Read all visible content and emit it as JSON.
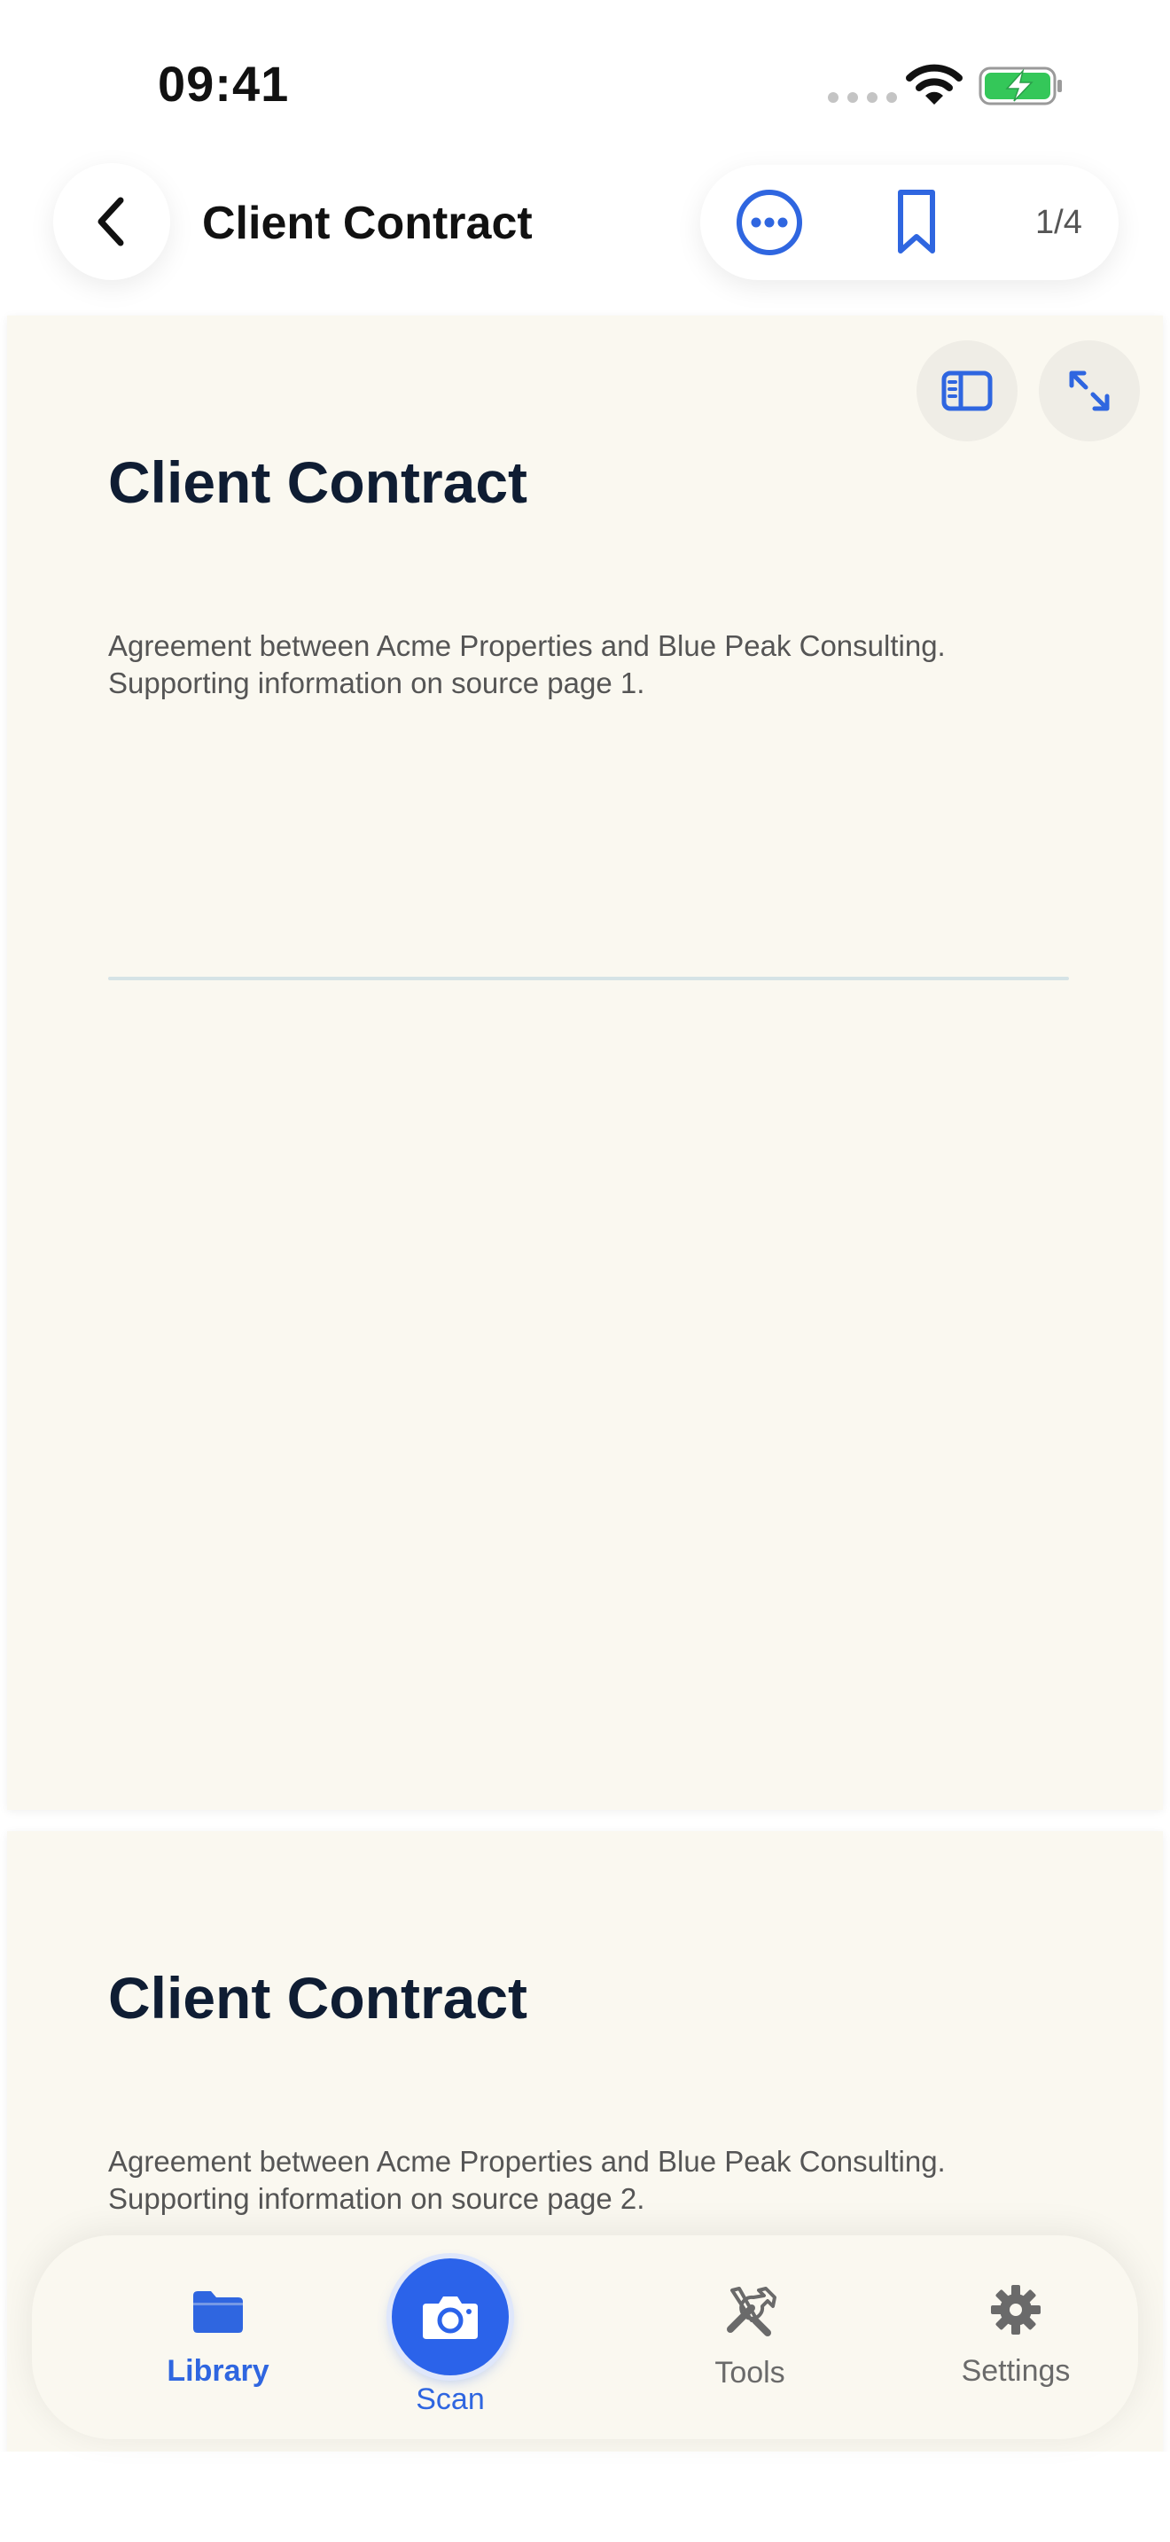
{
  "status_bar": {
    "time": "09:41"
  },
  "header": {
    "title": "Client Contract",
    "page_counter": "1/4"
  },
  "pages": [
    {
      "title": "Client Contract",
      "body_line1": "Agreement between Acme Properties and Blue Peak Consulting.",
      "body_line2": "Supporting information on source page 1."
    },
    {
      "title": "Client Contract",
      "body_line1": "Agreement between Acme Properties and Blue Peak Consulting.",
      "body_line2": "Supporting information on source page 2."
    }
  ],
  "tab_bar": {
    "tabs": [
      {
        "label": "Library",
        "icon": "folder-icon",
        "active": true
      },
      {
        "label": "Scan",
        "icon": "camera-icon",
        "active": false
      },
      {
        "label": "Tools",
        "icon": "tools-icon",
        "active": false
      },
      {
        "label": "Settings",
        "icon": "gear-icon",
        "active": false
      }
    ]
  },
  "colors": {
    "accent": "#2f66e0",
    "page_background": "#faf8f0",
    "heading": "#0f1d33",
    "battery_green": "#34c759"
  }
}
